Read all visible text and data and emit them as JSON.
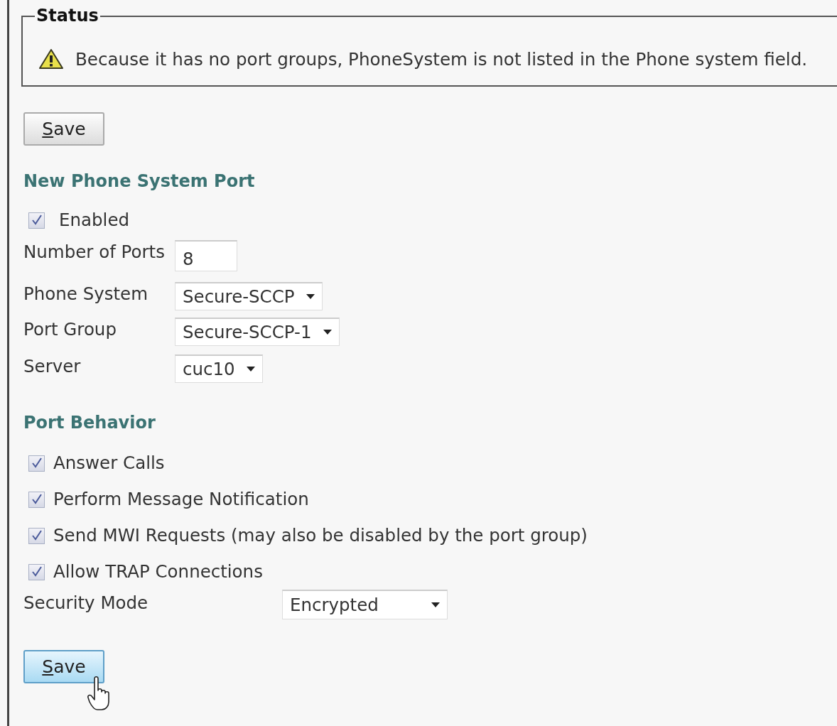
{
  "status": {
    "legend": "Status",
    "message": "Because it has no port groups, PhoneSystem is not listed in the Phone system field."
  },
  "top_button": {
    "label": "Save",
    "hovered": false
  },
  "port_section": {
    "heading": "New Phone System Port",
    "enabled": {
      "label": "Enabled",
      "checked": true
    },
    "fields": [
      {
        "kind": "text",
        "label": "Number of Ports",
        "value": "8"
      },
      {
        "kind": "select",
        "label": "Phone System",
        "value": "Secure-SCCP"
      },
      {
        "kind": "select",
        "label": "Port Group",
        "value": "Secure-SCCP-1"
      },
      {
        "kind": "select",
        "label": "Server",
        "value": "cuc10"
      }
    ]
  },
  "behavior_section": {
    "heading": "Port Behavior",
    "options": [
      {
        "label": "Answer Calls",
        "checked": true
      },
      {
        "label": "Perform Message Notification",
        "checked": true
      },
      {
        "label": "Send MWI Requests (may also be disabled by the port group)",
        "checked": true
      },
      {
        "label": "Allow TRAP Connections",
        "checked": true
      }
    ],
    "security_mode": {
      "label": "Security Mode",
      "value": "Encrypted"
    }
  },
  "bottom_button": {
    "label": "Save",
    "hovered": true
  }
}
